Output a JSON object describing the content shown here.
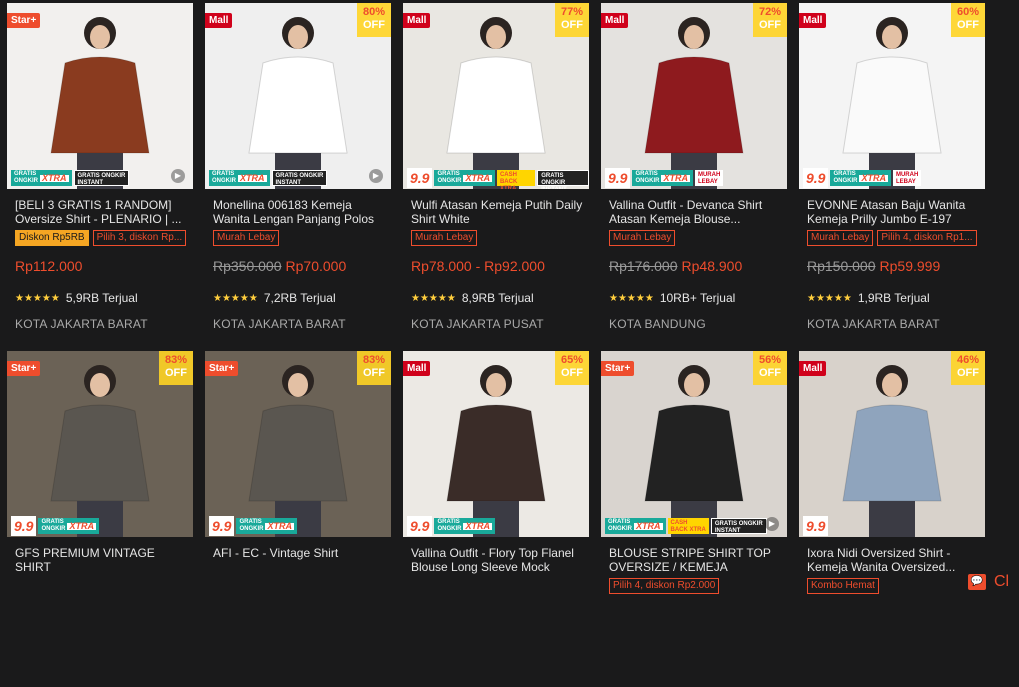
{
  "colors": {
    "accent": "#ee4d2d",
    "background": "#1a1a1b",
    "star": "#ffce3d"
  },
  "products": [
    {
      "badge": "Star+",
      "badge_type": "star",
      "discount_pct": "",
      "discount_off": "",
      "photo_bg": "#f2f0ee",
      "shirt": "#8a3b1f",
      "tags": [
        "gratis",
        "instant"
      ],
      "title": "[BELI 3 GRATIS 1 RANDOM] Oversize Shirt - PLENARIO | ...",
      "labels": [
        {
          "text": "Diskon Rp5RB",
          "style": "gold"
        },
        {
          "text": "Pilih 3, diskon Rp...",
          "style": "outline"
        }
      ],
      "price_old": "",
      "price": "Rp112.000",
      "rating": "5,9RB Terjual",
      "location": "KOTA JAKARTA BARAT"
    },
    {
      "badge": "Mall",
      "badge_type": "mall",
      "discount_pct": "80%",
      "discount_off": "OFF",
      "photo_bg": "#efefef",
      "shirt": "#ffffff",
      "tags": [
        "gratis",
        "instant"
      ],
      "title": "Monellina 006183 Kemeja Wanita Lengan Panjang Polos",
      "labels": [
        {
          "text": "Murah Lebay",
          "style": "outline"
        }
      ],
      "price_old": "Rp350.000",
      "price": "Rp70.000",
      "rating": "7,2RB Terjual",
      "location": "KOTA JAKARTA BARAT"
    },
    {
      "badge": "Mall",
      "badge_type": "mall",
      "discount_pct": "77%",
      "discount_off": "OFF",
      "photo_bg": "#e9e7e2",
      "shirt": "#ffffff",
      "tags": [
        "99",
        "gratis",
        "cashback",
        "instant"
      ],
      "title": "Wulfi Atasan Kemeja Putih Daily Shirt White",
      "labels": [
        {
          "text": "Murah Lebay",
          "style": "outline"
        }
      ],
      "price_old": "",
      "price": "Rp78.000 - Rp92.000",
      "rating": "8,9RB Terjual",
      "location": "KOTA JAKARTA PUSAT"
    },
    {
      "badge": "Mall",
      "badge_type": "mall",
      "discount_pct": "72%",
      "discount_off": "OFF",
      "photo_bg": "#e4e2df",
      "shirt": "#8e1a1e",
      "tags": [
        "99",
        "gratis",
        "murah"
      ],
      "title": "Vallina Outfit - Devanca Shirt Atasan Kemeja Blouse...",
      "labels": [
        {
          "text": "Murah Lebay",
          "style": "outline"
        }
      ],
      "price_old": "Rp176.000",
      "price": "Rp48.900",
      "rating": "10RB+ Terjual",
      "location": "KOTA BANDUNG"
    },
    {
      "badge": "Mall",
      "badge_type": "mall",
      "discount_pct": "60%",
      "discount_off": "OFF",
      "photo_bg": "#f4f4f4",
      "shirt": "#fafafa",
      "tags": [
        "99",
        "gratis",
        "murah"
      ],
      "title": "EVONNE Atasan Baju Wanita Kemeja Prilly Jumbo E-197",
      "labels": [
        {
          "text": "Murah Lebay",
          "style": "outline"
        },
        {
          "text": "Pilih 4, diskon Rp1...",
          "style": "outline"
        }
      ],
      "price_old": "Rp150.000",
      "price": "Rp59.999",
      "rating": "1,9RB Terjual",
      "location": "KOTA JAKARTA BARAT"
    },
    {
      "badge": "Star+",
      "badge_type": "star",
      "discount_pct": "83%",
      "discount_off": "OFF",
      "photo_bg": "#6b6256",
      "shirt": "#5a5650",
      "tags": [
        "99",
        "gratis"
      ],
      "title": "GFS PREMIUM VINTAGE SHIRT",
      "labels": [],
      "price_old": "",
      "price": "",
      "rating": "",
      "location": ""
    },
    {
      "badge": "Star+",
      "badge_type": "star",
      "discount_pct": "83%",
      "discount_off": "OFF",
      "photo_bg": "#6b6256",
      "shirt": "#5a5650",
      "tags": [
        "99",
        "gratis"
      ],
      "title": "AFI - EC - Vintage Shirt",
      "labels": [],
      "price_old": "",
      "price": "",
      "rating": "",
      "location": ""
    },
    {
      "badge": "Mall",
      "badge_type": "mall",
      "discount_pct": "65%",
      "discount_off": "OFF",
      "photo_bg": "#ece9e4",
      "shirt": "#3a2c28",
      "tags": [
        "99",
        "gratis"
      ],
      "title": "Vallina Outfit - Flory Top Flanel Blouse Long Sleeve Mock Two...",
      "labels": [],
      "price_old": "",
      "price": "",
      "rating": "",
      "location": ""
    },
    {
      "badge": "Star+",
      "badge_type": "star",
      "discount_pct": "56%",
      "discount_off": "OFF",
      "photo_bg": "#d9d4cf",
      "shirt": "#222222",
      "tags": [
        "gratis",
        "cashback",
        "instant"
      ],
      "title": "BLOUSE STRIPE SHIRT TOP OVERSIZE / KEMEJA ATASAN...",
      "labels": [
        {
          "text": "Pilih 4, diskon Rp2.000",
          "style": "outline"
        }
      ],
      "price_old": "",
      "price": "",
      "rating": "",
      "location": ""
    },
    {
      "badge": "Mall",
      "badge_type": "mall",
      "discount_pct": "46%",
      "discount_off": "OFF",
      "photo_bg": "#d8d2cb",
      "shirt": "#8fa4bd",
      "tags": [
        "99"
      ],
      "title": "Ixora Nidi Oversized Shirt - Kemeja Wanita Oversized...",
      "labels": [
        {
          "text": "Kombo Hemat",
          "style": "outline"
        }
      ],
      "price_old": "",
      "price": "",
      "rating": "",
      "location": ""
    }
  ],
  "strip_text": {
    "gratis_top": "GRATIS",
    "gratis_bottom": "ONGKIR",
    "xtra": "XTRA",
    "instant_top": "GRATIS ONGKIR",
    "instant_bottom": "INSTANT",
    "cashback_top": "CASH",
    "cashback_bottom": "BACK XTRA",
    "murah_top": "MURAH",
    "murah_bottom": "LEBAY",
    "nine": "9.9"
  },
  "chat_label": "Cl"
}
